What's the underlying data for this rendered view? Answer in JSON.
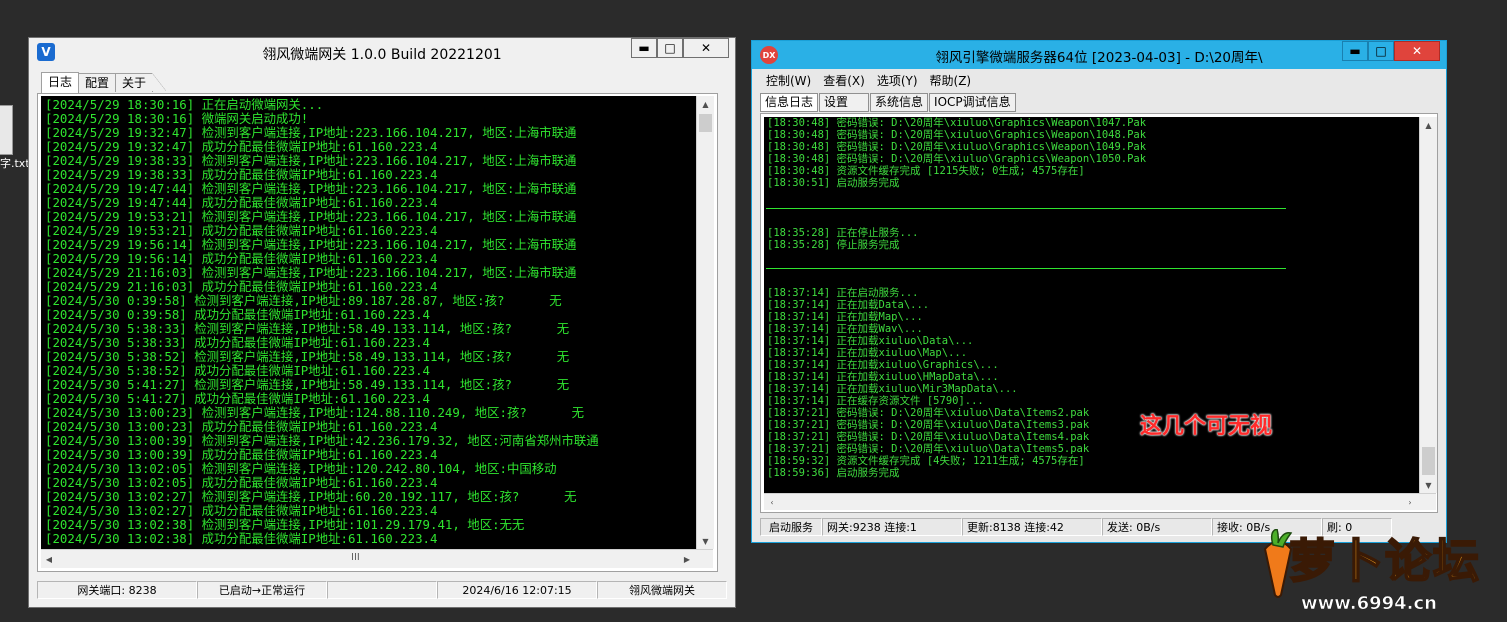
{
  "desktop": {
    "file_label": "字.txt"
  },
  "gateway_window": {
    "title": "翎风微端网关 1.0.0 Build 20221201",
    "icon_letter": "V",
    "tabs": [
      "日志",
      "配置",
      "关于"
    ],
    "log_lines": [
      "[2024/5/29 18:30:16] 正在启动微端网关...",
      "[2024/5/29 18:30:16] 微端网关启动成功!",
      "[2024/5/29 19:32:47] 检测到客户端连接,IP地址:223.166.104.217, 地区:上海市联通",
      "[2024/5/29 19:32:47] 成功分配最佳微端IP地址:61.160.223.4",
      "[2024/5/29 19:38:33] 检测到客户端连接,IP地址:223.166.104.217, 地区:上海市联通",
      "[2024/5/29 19:38:33] 成功分配最佳微端IP地址:61.160.223.4",
      "[2024/5/29 19:47:44] 检测到客户端连接,IP地址:223.166.104.217, 地区:上海市联通",
      "[2024/5/29 19:47:44] 成功分配最佳微端IP地址:61.160.223.4",
      "[2024/5/29 19:53:21] 检测到客户端连接,IP地址:223.166.104.217, 地区:上海市联通",
      "[2024/5/29 19:53:21] 成功分配最佳微端IP地址:61.160.223.4",
      "[2024/5/29 19:56:14] 检测到客户端连接,IP地址:223.166.104.217, 地区:上海市联通",
      "[2024/5/29 19:56:14] 成功分配最佳微端IP地址:61.160.223.4",
      "[2024/5/29 21:16:03] 检测到客户端连接,IP地址:223.166.104.217, 地区:上海市联通",
      "[2024/5/29 21:16:03] 成功分配最佳微端IP地址:61.160.223.4",
      "[2024/5/30 0:39:58] 检测到客户端连接,IP地址:89.187.28.87, 地区:孩?      无",
      "[2024/5/30 0:39:58] 成功分配最佳微端IP地址:61.160.223.4",
      "[2024/5/30 5:38:33] 检测到客户端连接,IP地址:58.49.133.114, 地区:孩?      无",
      "[2024/5/30 5:38:33] 成功分配最佳微端IP地址:61.160.223.4",
      "[2024/5/30 5:38:52] 检测到客户端连接,IP地址:58.49.133.114, 地区:孩?      无",
      "[2024/5/30 5:38:52] 成功分配最佳微端IP地址:61.160.223.4",
      "[2024/5/30 5:41:27] 检测到客户端连接,IP地址:58.49.133.114, 地区:孩?      无",
      "[2024/5/30 5:41:27] 成功分配最佳微端IP地址:61.160.223.4",
      "[2024/5/30 13:00:23] 检测到客户端连接,IP地址:124.88.110.249, 地区:孩?      无",
      "[2024/5/30 13:00:23] 成功分配最佳微端IP地址:61.160.223.4",
      "[2024/5/30 13:00:39] 检测到客户端连接,IP地址:42.236.179.32, 地区:河南省郑州市联通",
      "[2024/5/30 13:00:39] 成功分配最佳微端IP地址:61.160.223.4",
      "[2024/5/30 13:02:05] 检测到客户端连接,IP地址:120.242.80.104, 地区:中国移动",
      "[2024/5/30 13:02:05] 成功分配最佳微端IP地址:61.160.223.4",
      "[2024/5/30 13:02:27] 检测到客户端连接,IP地址:60.20.192.117, 地区:孩?      无",
      "[2024/5/30 13:02:27] 成功分配最佳微端IP地址:61.160.223.4",
      "[2024/5/30 13:02:38] 检测到客户端连接,IP地址:101.29.179.41, 地区:无无",
      "[2024/5/30 13:02:38] 成功分配最佳微端IP地址:61.160.223.4"
    ],
    "hscroll_thumb_glyph": "III",
    "status": [
      "网关端口: 8238",
      "已启动→正常运行",
      "",
      "2024/6/16 12:07:15",
      "翎风微端网关"
    ]
  },
  "server_window": {
    "title": "翎风引擎微端服务器64位 [2023-04-03] - D:\\20周年\\",
    "icon_text": "DX",
    "menu": [
      "控制(W)",
      "查看(X)",
      "选项(Y)",
      "帮助(Z)"
    ],
    "tabs": [
      "信息日志",
      "设置",
      "系统信息",
      "IOCP调试信息"
    ],
    "log_group1": [
      "[18:30:48] 密码错误: D:\\20周年\\xiuluo\\Graphics\\Weapon\\1047.Pak",
      "[18:30:48] 密码错误: D:\\20周年\\xiuluo\\Graphics\\Weapon\\1048.Pak",
      "[18:30:48] 密码错误: D:\\20周年\\xiuluo\\Graphics\\Weapon\\1049.Pak",
      "[18:30:48] 密码错误: D:\\20周年\\xiuluo\\Graphics\\Weapon\\1050.Pak",
      "[18:30:48] 资源文件缓存完成 [1215失败; 0生成; 4575存在]",
      "[18:30:51] 启动服务完成"
    ],
    "log_group2": [
      "[18:35:28] 正在停止服务...",
      "[18:35:28] 停止服务完成"
    ],
    "log_group3": [
      "[18:37:14] 正在启动服务...",
      "[18:37:14] 正在加载Data\\...",
      "[18:37:14] 正在加载Map\\...",
      "[18:37:14] 正在加载Wav\\...",
      "[18:37:14] 正在加载xiuluo\\Data\\...",
      "[18:37:14] 正在加载xiuluo\\Map\\...",
      "[18:37:14] 正在加载xiuluo\\Graphics\\...",
      "[18:37:14] 正在加载xiuluo\\HMapData\\...",
      "[18:37:14] 正在加载xiuluo\\Mir3MapData\\...",
      "[18:37:14] 正在缓存资源文件 [5790]...",
      "[18:37:21] 密码错误: D:\\20周年\\xiuluo\\Data\\Items2.pak",
      "[18:37:21] 密码错误: D:\\20周年\\xiuluo\\Data\\Items3.pak",
      "[18:37:21] 密码错误: D:\\20周年\\xiuluo\\Data\\Items4.pak",
      "[18:37:21] 密码错误: D:\\20周年\\xiuluo\\Data\\Items5.pak",
      "[18:59:32] 资源文件缓存完成 [4失败; 1211生成; 4575存在]",
      "[18:59:36] 启动服务完成"
    ],
    "annotation": "这几个可无视",
    "status": [
      "启动服务",
      "网关:9238  连接:1",
      "更新:8138  连接:42",
      "发送: 0B/s",
      "接收: 0B/s",
      "刷: 0"
    ]
  },
  "watermark": {
    "logo_text": "萝卜论坛",
    "url": "www.6994.cn"
  }
}
